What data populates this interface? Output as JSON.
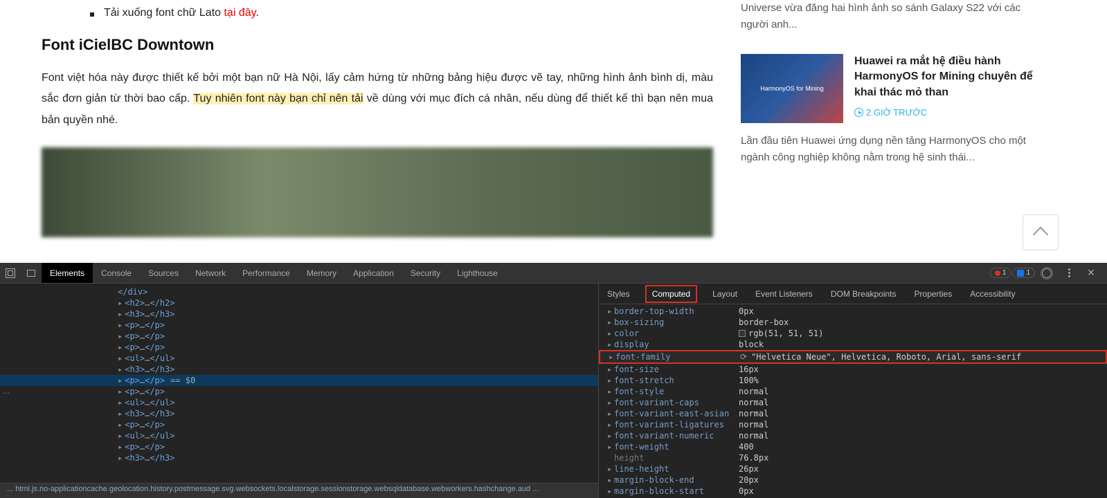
{
  "article": {
    "bullet_prefix": "Tải xuống font chữ Lato ",
    "bullet_link": "tại đây",
    "bullet_suffix": ".",
    "h": "Font iCielBC Downtown",
    "p1_a": "Font việt hóa này được thiết kế bởi một bạn nữ Hà Nội, lấy cảm hứng từ những bảng hiệu được vẽ tay, những hình ảnh bình dị, màu sắc đơn giản từ thời bao cấp. ",
    "p1_hl": "Tuy nhiên font này bạn chỉ nên tải",
    "p1_b": " về dùng với mục đích cá nhân, nếu dùng để thiết kế thì bạn nên mua bản quyền nhé."
  },
  "sidebar": {
    "top_text": "Universe vừa đăng hai hình ảnh so sánh Galaxy S22 với các người anh...",
    "item": {
      "thumb_text": "HarmonyOS for Mining",
      "title": "Huawei ra mắt hệ điều hành HarmonyOS for Mining chuyên để khai thác mỏ than",
      "time": "2 GIỜ TRƯỚC"
    },
    "bottom_text": "Lần đầu tiên Huawei ứng dụng nền tảng HarmonyOS cho một ngành công nghiệp không nằm trong hệ sinh thái..."
  },
  "devtools": {
    "tabs": [
      "Elements",
      "Console",
      "Sources",
      "Network",
      "Performance",
      "Memory",
      "Application",
      "Security",
      "Lighthouse"
    ],
    "active_tab": "Elements",
    "error_count": "1",
    "info_count": "1",
    "elements": [
      {
        "indent": 0,
        "open": "</div>",
        "closing": true
      },
      {
        "indent": 0,
        "open": "<h2>",
        "close": "</h2>",
        "has_arrow": true
      },
      {
        "indent": 0,
        "open": "<h3>",
        "close": "</h3>",
        "has_arrow": true
      },
      {
        "indent": 0,
        "open": "<p>",
        "close": "</p>",
        "has_arrow": true
      },
      {
        "indent": 0,
        "open": "<p>",
        "close": "</p>",
        "has_arrow": true
      },
      {
        "indent": 0,
        "open": "<p>",
        "close": "</p>",
        "has_arrow": true
      },
      {
        "indent": 0,
        "open": "<ul>",
        "close": "</ul>",
        "has_arrow": true
      },
      {
        "indent": 0,
        "open": "<h3>",
        "close": "</h3>",
        "has_arrow": true
      },
      {
        "indent": 0,
        "open": "<p>",
        "close": "</p>",
        "has_arrow": true,
        "selected": true,
        "eq": "== $0"
      },
      {
        "indent": 0,
        "open": "<p>",
        "close": "</p>",
        "has_arrow": true
      },
      {
        "indent": 0,
        "open": "<ul>",
        "close": "</ul>",
        "has_arrow": true
      },
      {
        "indent": 0,
        "open": "<h3>",
        "close": "</h3>",
        "has_arrow": true
      },
      {
        "indent": 0,
        "open": "<p>",
        "close": "</p>",
        "has_arrow": true
      },
      {
        "indent": 0,
        "open": "<ul>",
        "close": "</ul>",
        "has_arrow": true
      },
      {
        "indent": 0,
        "open": "<p>",
        "close": "</p>",
        "has_arrow": true
      },
      {
        "indent": 0,
        "open": "<h3>",
        "close": "</h3>",
        "has_arrow": true
      }
    ],
    "crumb": "... html.js.no-applicationcache.geolocation.history.postmessage.svg.websockets.localstorage.sessionstorage.websqldatabase.webworkers.hashchange.aud ...",
    "style_tabs": [
      "Styles",
      "Computed",
      "Layout",
      "Event Listeners",
      "DOM Breakpoints",
      "Properties",
      "Accessibility"
    ],
    "style_active": "Computed",
    "computed": [
      {
        "prop": "border-top-width",
        "val": "0px"
      },
      {
        "prop": "box-sizing",
        "val": "border-box"
      },
      {
        "prop": "color",
        "val": "rgb(51, 51, 51)",
        "chip": true
      },
      {
        "prop": "display",
        "val": "block"
      },
      {
        "prop": "font-family",
        "val": "\"Helvetica Neue\", Helvetica, Roboto, Arial, sans-serif",
        "hl": true,
        "go": true
      },
      {
        "prop": "font-size",
        "val": "16px"
      },
      {
        "prop": "font-stretch",
        "val": "100%"
      },
      {
        "prop": "font-style",
        "val": "normal"
      },
      {
        "prop": "font-variant-caps",
        "val": "normal"
      },
      {
        "prop": "font-variant-east-asian",
        "val": "normal"
      },
      {
        "prop": "font-variant-ligatures",
        "val": "normal"
      },
      {
        "prop": "font-variant-numeric",
        "val": "normal"
      },
      {
        "prop": "font-weight",
        "val": "400"
      },
      {
        "prop": "height",
        "val": "76.8px",
        "dim": true,
        "no_arrow": true
      },
      {
        "prop": "line-height",
        "val": "26px"
      },
      {
        "prop": "margin-block-end",
        "val": "20px"
      },
      {
        "prop": "margin-block-start",
        "val": "0px"
      }
    ]
  }
}
